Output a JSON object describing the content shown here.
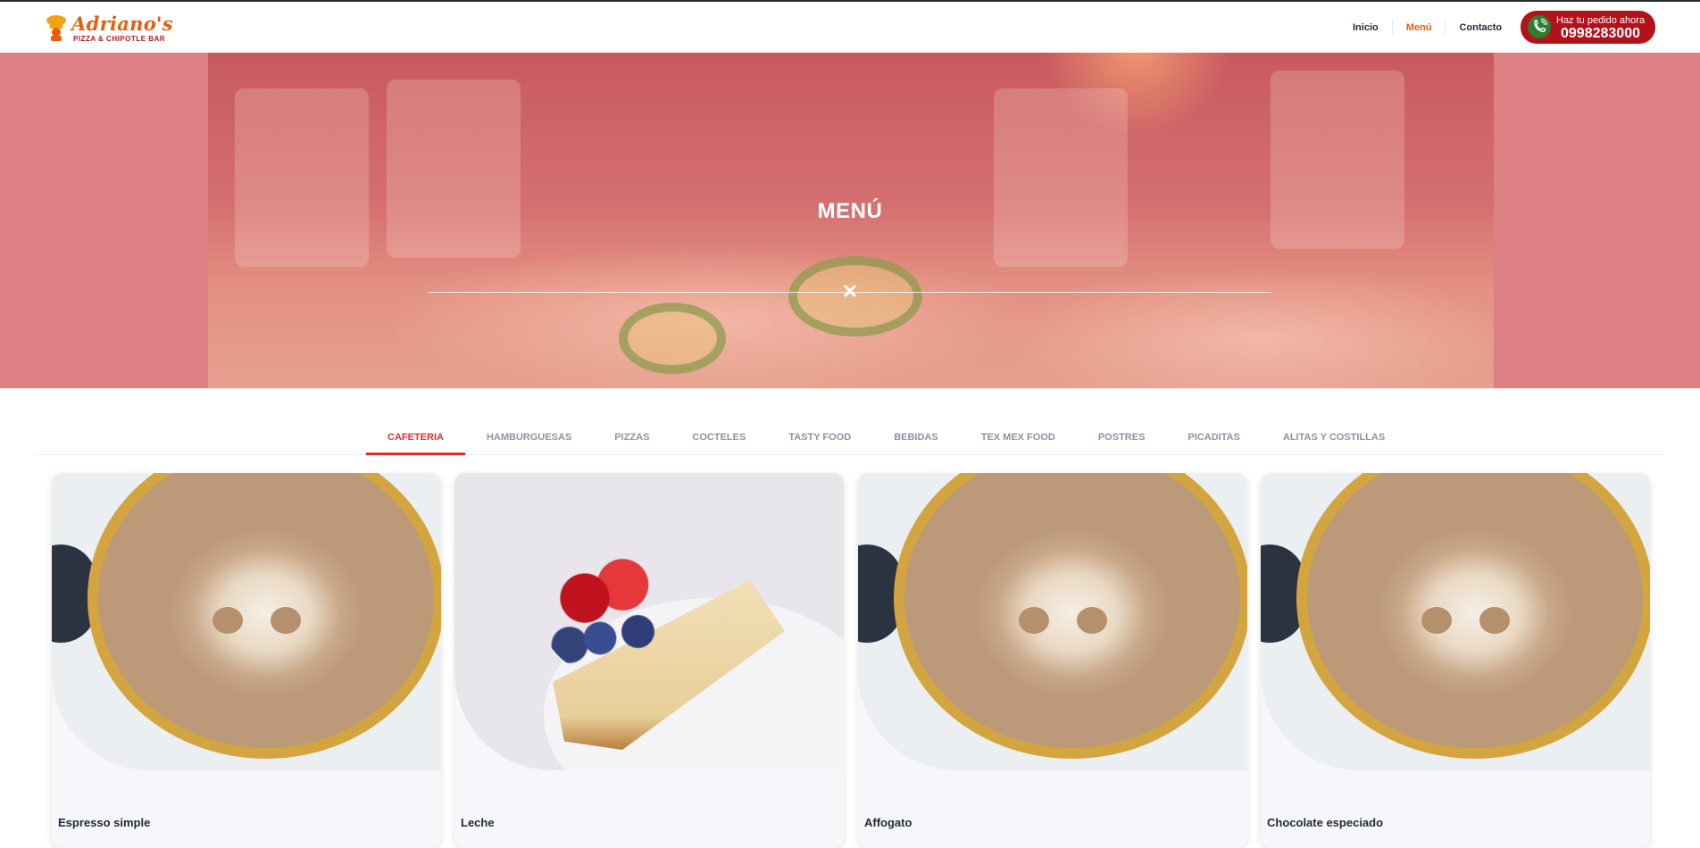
{
  "header": {
    "logo_name": "Adriano's",
    "logo_subtitle": "PIZZA & CHIPOTLE BAR",
    "nav": [
      {
        "label": "Inicio",
        "active": false
      },
      {
        "label": "Menú",
        "active": true
      },
      {
        "label": "Contacto",
        "active": false
      }
    ],
    "call_to_action": {
      "label": "Haz tu pedido ahora",
      "phone": "0998283000",
      "icon": "phone-icon"
    }
  },
  "hero": {
    "title": "MENÚ",
    "close_glyph": "✕"
  },
  "tabs": [
    {
      "label": "CAFETERIA",
      "active": true
    },
    {
      "label": "HAMBURGUESAS",
      "active": false
    },
    {
      "label": "PIZZAS",
      "active": false
    },
    {
      "label": "COCTELES",
      "active": false
    },
    {
      "label": "TASTY FOOD",
      "active": false
    },
    {
      "label": "BEBIDAS",
      "active": false
    },
    {
      "label": "TEX MEX FOOD",
      "active": false
    },
    {
      "label": "POSTRES",
      "active": false
    },
    {
      "label": "PICADITAS",
      "active": false
    },
    {
      "label": "ALITAS Y COSTILLAS",
      "active": false
    }
  ],
  "products": [
    {
      "name": "Espresso simple",
      "image": "latte-art"
    },
    {
      "name": "Leche",
      "image": "cheesecake"
    },
    {
      "name": "Affogato",
      "image": "latte-art"
    },
    {
      "name": "Chocolate especiado",
      "image": "latte-art"
    }
  ],
  "colors": {
    "brand_orange": "#e85d0b",
    "brand_red": "#b3121a",
    "tab_active": "#e52d27",
    "hero_overlay": "#dc8084"
  }
}
